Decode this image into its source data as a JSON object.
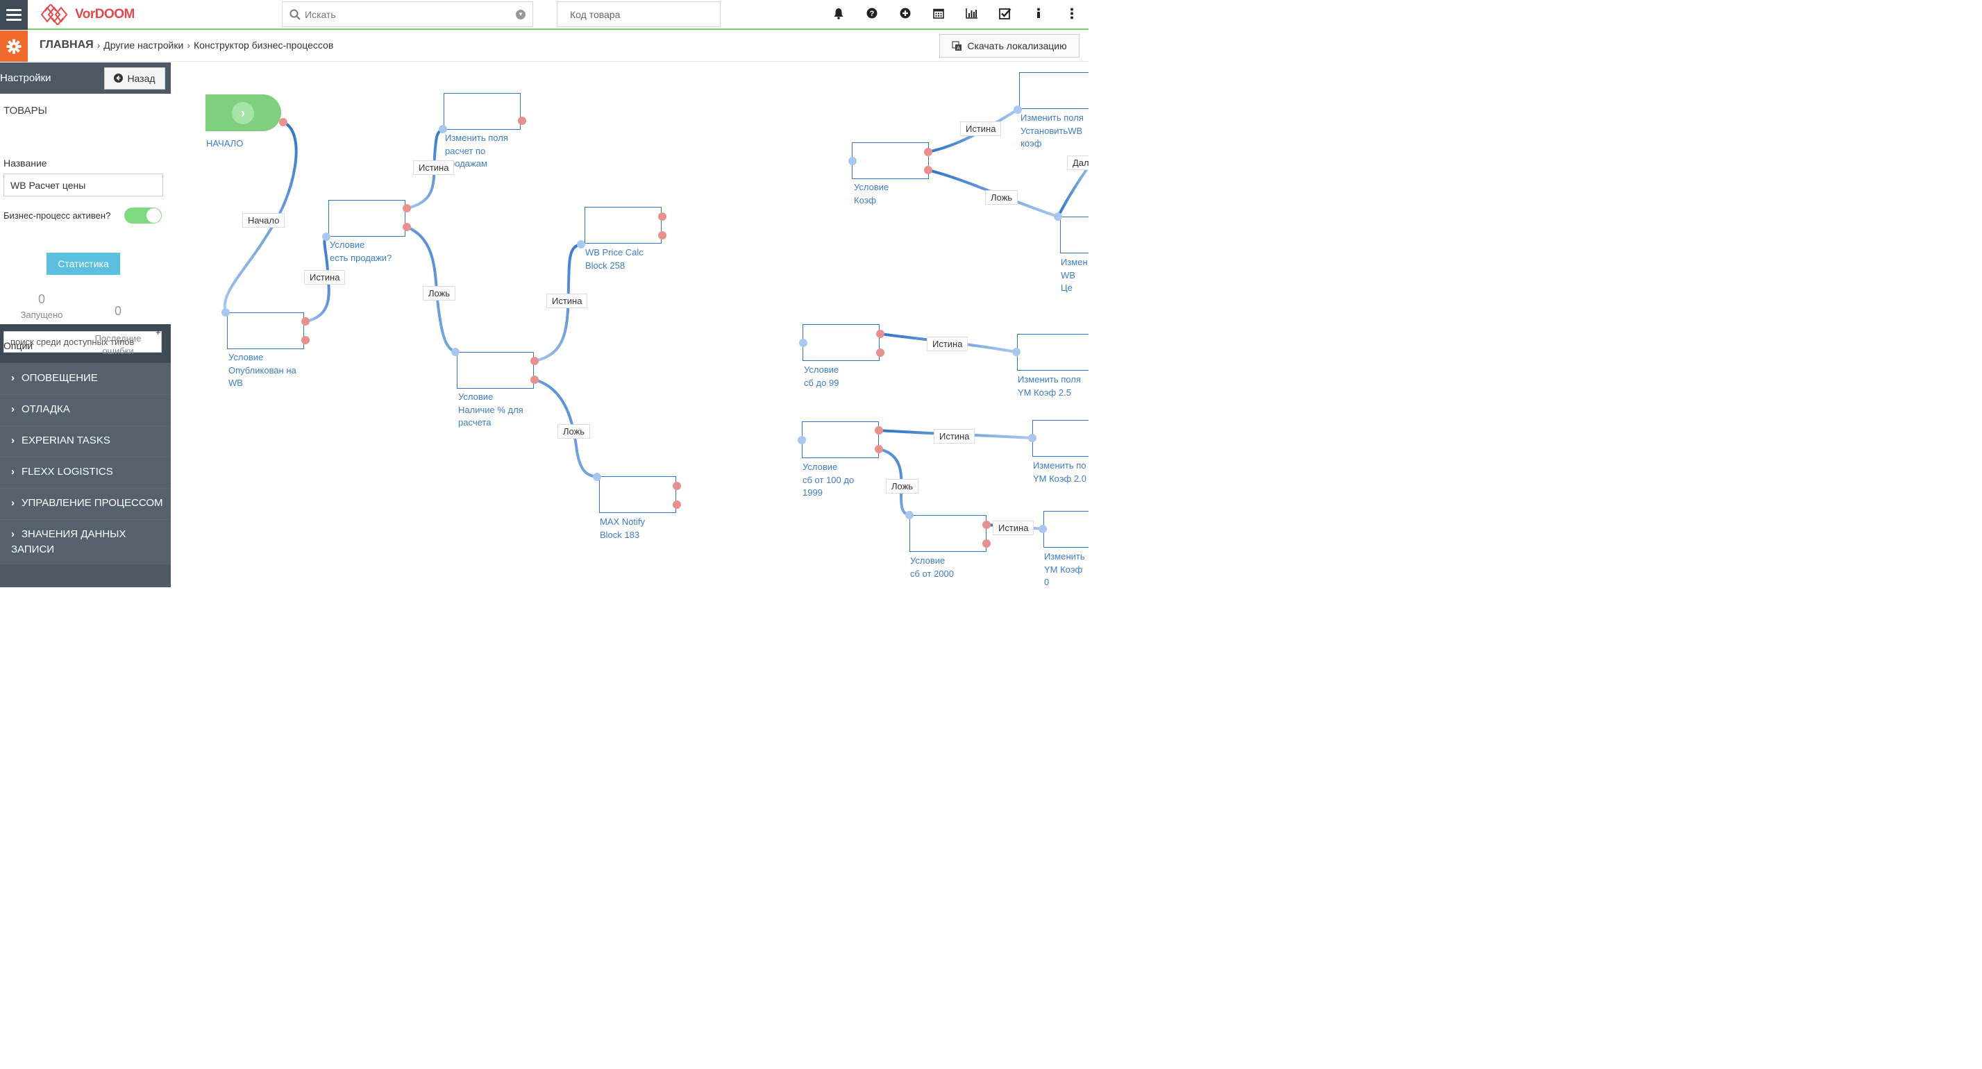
{
  "app": {
    "logo_text": "VorDOOM"
  },
  "topbar": {
    "search_placeholder": "Искать",
    "code_placeholder": "Код товара",
    "icons": [
      "bell-icon",
      "help-icon",
      "add-icon",
      "calendar-icon",
      "chart-icon",
      "checkbox-icon",
      "info-icon",
      "more-icon"
    ]
  },
  "breadcrumb": {
    "home": "ГЛАВНАЯ",
    "items": [
      "Другие настройки",
      "Конструктор бизнес-процессов"
    ],
    "download_label": "Скачать локализацию"
  },
  "sidebar": {
    "title": "Настройки",
    "back_label": "Назад",
    "section": "ТОВАРЫ",
    "name_label": "Название",
    "name_value": "WB Расчет цены",
    "active_label": "Бизнес-процесс активен?",
    "active": true,
    "stat_button": "Статистика",
    "launched_count": "0",
    "launched_label": "Запущено",
    "errors_count": "0",
    "errors_label": "Последние\nошибки",
    "plus": "+",
    "options_label": "Опции",
    "search_placeholder": "поиск среди доступных типов",
    "items": [
      "ОПОВЕЩЕНИЕ",
      "ОТЛАДКА",
      "EXPERIAN TASKS",
      "FLEXX LOGISTICS",
      "УПРАВЛЕНИЕ ПРОЦЕССОМ",
      "ЗНАЧЕНИЯ ДАННЫХ ЗАПИСИ"
    ]
  },
  "canvas": {
    "start_label": "НАЧАЛО",
    "nodes": [
      "Условие\nОпубликован на\nWB",
      "Условие\nесть продажи?",
      "Изменить поля\nрасчет по\nпродажам",
      "Условие\nНаличие % для\nрасчета",
      "WB Price Calc\nBlock 258",
      "MAX Notify\nBlock 183",
      "Условие\nКоэф",
      "Изменить поля\nУстановитьWB\nкоэф",
      "Измен\nWB Це",
      "Условие\nсб до 99",
      "Изменить поля\nYM Коэф 2.5",
      "Условие\nсб от 100 до\n1999",
      "Изменить по\nYM Коэф 2.0",
      "Условие\nсб от 2000",
      "Изменить\nYM Коэф 0"
    ],
    "edge_labels": [
      "Начало",
      "Истина",
      "Истина",
      "Ложь",
      "Истина",
      "Ложь",
      "Истина",
      "Ложь",
      "Дал",
      "Истина",
      "Истина",
      "Ложь",
      "Истина"
    ]
  }
}
